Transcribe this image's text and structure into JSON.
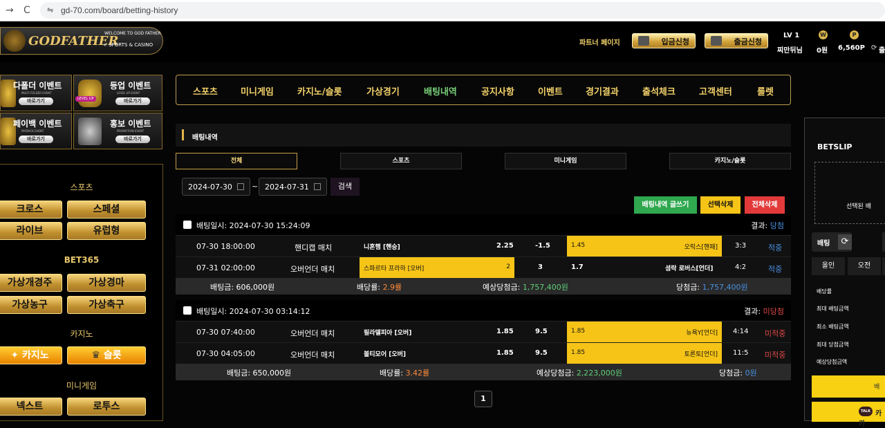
{
  "browser": {
    "back": "→",
    "reload": "C",
    "site_icon": "⇋",
    "url": "gd-70.com/board/betting-history"
  },
  "header": {
    "logo_main": "GODFATHER",
    "logo_sub1": "WELCOME TO GOD FATHER",
    "logo_sub2": "+ SPORTS & CASINO",
    "partner": "파트너 페이지",
    "deposit": "입금신청",
    "withdraw": "출금신청",
    "level": "LV 1",
    "username": "찌만뒤님",
    "won_icon": "W",
    "won": "0원",
    "point_icon": "P",
    "points": "6,560P",
    "refresh": "⟳",
    "truncated": "출"
  },
  "banners": [
    {
      "title": "다폴더 이벤트",
      "sub": "MULTI FOLDER EVENT",
      "btn": "바로가기"
    },
    {
      "title": "등업 이벤트",
      "sub": "LEVEL UP EVENT",
      "btn": "바로가기",
      "badge": "LEVEL UP"
    },
    {
      "title": "페이백 이벤트",
      "sub": "PAYBACK EVENT",
      "btn": "바로가기"
    },
    {
      "title": "홍보 이벤트",
      "sub": "PROMOTION EVENT",
      "btn": "바로가기"
    }
  ],
  "leftmenu": {
    "sports_title": "스포츠",
    "cross": "크로스",
    "special": "스페셜",
    "live": "라이브",
    "euro": "유럽형",
    "bet365_title": "BET365",
    "v_race": "가상개경주",
    "v_horse": "가상경마",
    "v_basket": "가상농구",
    "v_soccer": "가상축구",
    "casino_title": "카지노",
    "casino": "카지노",
    "slot": "슬롯",
    "mini_title": "미니게임",
    "next": "넥스트",
    "lotus": "로투스"
  },
  "nav": [
    "스포츠",
    "미니게임",
    "카지노/슬롯",
    "가상경기",
    "배팅내역",
    "공지사항",
    "이벤트",
    "경기결과",
    "출석체크",
    "고객센터",
    "룰렛"
  ],
  "page": {
    "title": "배팅내역",
    "tabs": [
      "전체",
      "스포츠",
      "미니게임",
      "카지노/슬롯"
    ],
    "date_from": "2024-07-30",
    "date_to": "2024-07-31",
    "tilde": "~",
    "search": "검색",
    "btn_export": "배팅내역 글쓰기",
    "btn_del_sel": "선택삭제",
    "btn_del_all": "전체삭제",
    "page_num": "1"
  },
  "bets": [
    {
      "datetime": "배팅일시: 2024-07-30 15:24:09",
      "result_label": "결과: ",
      "result": "당첨",
      "rows": [
        {
          "time": "07-30 18:00:00",
          "type": "핸디캡 매치",
          "home": "니혼햄 [핸승]",
          "home_odds": "2.25",
          "line": "-1.5",
          "away_odds": "1.45",
          "away": "오릭스[핸패]",
          "score": "3:3",
          "status": "적중"
        },
        {
          "time": "07-31 02:00:00",
          "type": "오버언더 매치",
          "home": "스파르타 프라하 [오버]",
          "home_odds": "2",
          "line": "3",
          "away_odds": "1.7",
          "away": "셤락 로버스[언더]",
          "score": "4:2",
          "status": "적중"
        }
      ],
      "stake": "배팅금: 606,000원",
      "odds_label": "배당률: ",
      "odds": "2.9률",
      "expected_label": "예상당첨금: ",
      "expected": "1,757,400원",
      "won_label": "당첨금: ",
      "won": "1,757,400원"
    },
    {
      "datetime": "배팅일시: 2024-07-30 03:14:12",
      "result_label": "결과: ",
      "result": "미당첨",
      "rows": [
        {
          "time": "07-30 07:40:00",
          "type": "오버언더 매치",
          "home": "필라델피아 [오버]",
          "home_odds": "1.85",
          "line": "9.5",
          "away_odds": "1.85",
          "away": "뉴욕Y[언더]",
          "score": "4:14",
          "status": "미적중"
        },
        {
          "time": "07-30 04:05:00",
          "type": "오버언더 매치",
          "home": "볼티모어 [오버]",
          "home_odds": "1.85",
          "line": "9.5",
          "away_odds": "1.85",
          "away": "토론토[언더]",
          "score": "11:5",
          "status": "미적중"
        }
      ],
      "stake": "배팅금: 650,000원",
      "odds_label": "배당률: ",
      "odds": "3.42률",
      "expected_label": "예상당첨금: ",
      "expected": "2,223,000원",
      "won_label": "당첨금: ",
      "won": "0원"
    }
  ],
  "betslip": {
    "title": "BETSLIP",
    "empty": "선택된 배",
    "bet": "배팅",
    "refresh_icon": "⟳",
    "all": "올인",
    "am": "오전",
    "rows": [
      "배당률",
      "최대 배팅금액",
      "최소 배팅금액",
      "최대 당첨금액",
      "예상당첨금액"
    ],
    "yellow_text": "배",
    "kakao_badge": "TALK",
    "kakao": "카카"
  },
  "colors": {
    "gold": "#e8c76a",
    "highlight": "#f6c417",
    "win": "#4a90e2",
    "lose": "#e04848",
    "green": "#2fa84f",
    "red": "#e23a3a"
  }
}
